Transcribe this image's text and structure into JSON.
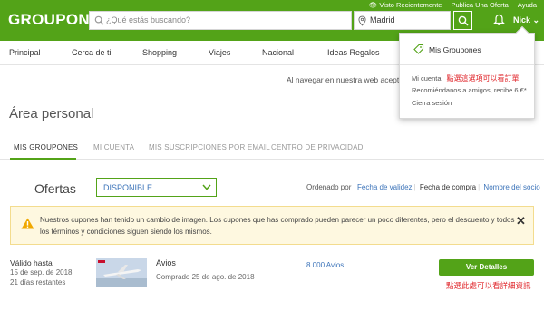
{
  "header": {
    "logo": "GROUPON",
    "recently_viewed": "Visto Recientemente",
    "publish_offer": "Publica Una Oferta",
    "help": "Ayuda",
    "search_placeholder": "¿Qué estás buscando?",
    "location": "Madrid",
    "user": "Nick"
  },
  "nav": [
    "Principal",
    "Cerca de ti",
    "Shopping",
    "Viajes",
    "Nacional",
    "Ideas Regalos"
  ],
  "notice": "Al navegar en nuestra web aceptas",
  "page_title": "Área personal",
  "tabs": [
    "MIS GROUPONES",
    "MI CUENTA",
    "MIS SUSCRIPCIONES POR EMAIL",
    "CENTRO DE PRIVACIDAD"
  ],
  "offers": {
    "label": "Ofertas",
    "filter": "DISPONIBLE",
    "sort_label": "Ordenado por",
    "sort_options": [
      "Fecha de validez",
      "Fecha de compra",
      "Nombre del socio"
    ]
  },
  "alert": {
    "message": "Nuestros cupones han tenido un cambio de imagen. Los cupones que has comprado pueden parecer un poco diferentes, pero el descuento y todos los términos y condiciones siguen siendo los mismos.",
    "close": "✕"
  },
  "coupon": {
    "valid_label": "Válido hasta",
    "valid_date": "15 de sep. de 2018",
    "days_left": "21 días restantes",
    "deal_name": "Avios",
    "purchased": "Comprado 25 de ago. de 2018",
    "points": "8.000 Avios",
    "view_button": "Ver Detalles",
    "annotation": "點選此處可以看詳細資訊"
  },
  "dropdown": {
    "my_groupons": "Mis Groupones",
    "my_account": "Mi cuenta",
    "annotation": "點選這選項可以看訂單",
    "recommend": "Recomiéndanos a amigos, recibe 6 €*",
    "logout": "Cierra sesión"
  },
  "colors": {
    "brand_green": "#53a318",
    "link_blue": "#3b73b9",
    "annotation_red": "#e0262b",
    "alert_bg": "#fef8e0"
  }
}
